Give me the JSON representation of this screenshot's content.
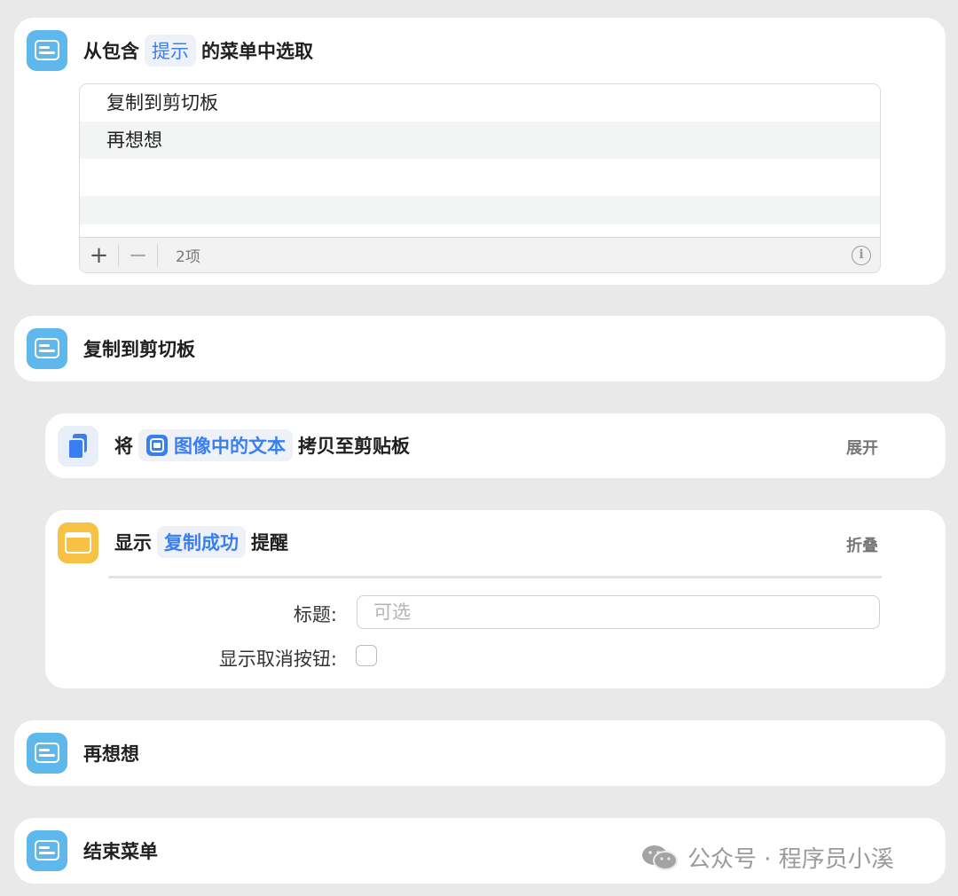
{
  "menu_action": {
    "title_prefix": "从包含",
    "title_token": "提示",
    "title_suffix": "的菜单中选取",
    "items": [
      "复制到剪切板",
      "再想想"
    ],
    "add_symbol": "+",
    "remove_symbol": "−",
    "item_count": "2项",
    "info_symbol": "i"
  },
  "case_copy": {
    "title": "复制到剪切板"
  },
  "copy_action": {
    "title_prefix": "将",
    "title_token": "图像中的文本",
    "title_suffix": "拷贝至剪贴板",
    "expand_label": "展开"
  },
  "alert_action": {
    "title_prefix": "显示",
    "title_token": "复制成功",
    "title_suffix": "提醒",
    "collapse_label": "折叠",
    "title_field_label": "标题:",
    "title_field_placeholder": "可选",
    "cancel_button_label": "显示取消按钮:"
  },
  "case_rethink": {
    "title": "再想想"
  },
  "end_menu": {
    "title": "结束菜单"
  },
  "watermark": {
    "text": "公众号 · 程序员小溪"
  },
  "colors": {
    "background": "#e9e9e9",
    "menu_icon": "#5fb8ec",
    "alert_icon": "#f7c244",
    "token_text": "#3a7ff2"
  }
}
